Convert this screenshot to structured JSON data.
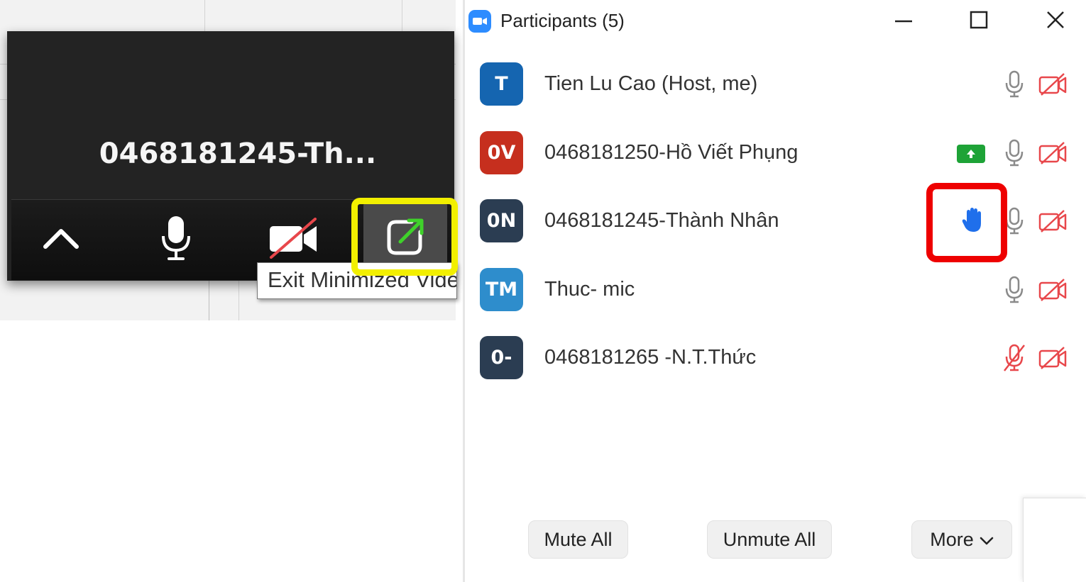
{
  "mini_video": {
    "participant_name": "0468181245-Th...",
    "tooltip": "Exit Minimized Video",
    "controls": [
      {
        "name": "expand",
        "icon": "chevron-up-icon"
      },
      {
        "name": "mic",
        "icon": "microphone-icon"
      },
      {
        "name": "video",
        "icon": "video-off-icon"
      },
      {
        "name": "exit-minimized",
        "icon": "exit-minimized-icon"
      }
    ]
  },
  "participants_panel": {
    "title": "Participants (5)",
    "window_controls": [
      "minimize-icon",
      "maximize-icon",
      "close-icon"
    ],
    "participants": [
      {
        "initials": "T",
        "name": "Tien Lu Cao (Host, me)",
        "avatar_color": "#1565b0",
        "sharing": false,
        "hand_raised": false,
        "mic_muted": false,
        "video_off": true
      },
      {
        "initials": "0V",
        "name": "0468181250-Hồ Viết Phụng",
        "avatar_color": "#c62f1e",
        "sharing": true,
        "hand_raised": false,
        "mic_muted": false,
        "video_off": true
      },
      {
        "initials": "0N",
        "name": "0468181245-Thành Nhân",
        "avatar_color": "#2b3d52",
        "sharing": false,
        "hand_raised": true,
        "mic_muted": false,
        "video_off": true
      },
      {
        "initials": "TM",
        "name": "Thuc- mic",
        "avatar_color": "#2e8dcc",
        "sharing": false,
        "hand_raised": false,
        "mic_muted": false,
        "video_off": true
      },
      {
        "initials": "0-",
        "name": "0468181265 -N.T.Thức",
        "avatar_color": "#2b3d52",
        "sharing": false,
        "hand_raised": false,
        "mic_muted": true,
        "video_off": true
      }
    ],
    "footer": {
      "mute_all": "Mute All",
      "unmute_all": "Unmute All",
      "more": "More"
    }
  },
  "colors": {
    "highlight_yellow": "#f2ef00",
    "highlight_red": "#ee0000",
    "zoom_blue": "#2d8cff",
    "muted_red": "#e8474b"
  }
}
